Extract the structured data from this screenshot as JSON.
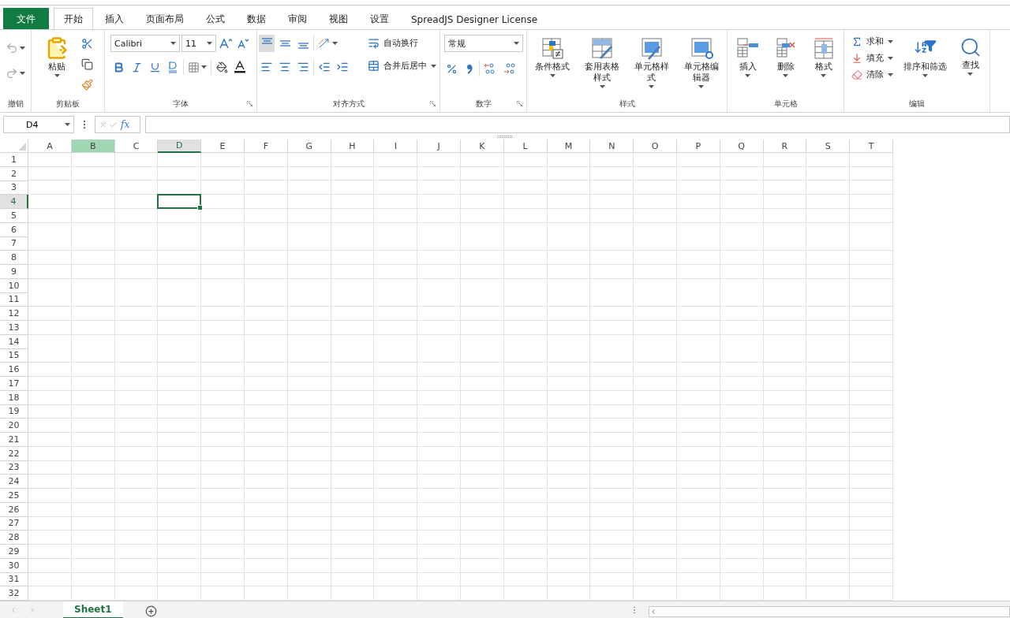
{
  "tabs": [
    {
      "label": "文件",
      "kind": "file",
      "selected": false
    },
    {
      "label": "开始",
      "kind": "tab",
      "selected": true
    },
    {
      "label": "插入",
      "kind": "tab",
      "selected": false
    },
    {
      "label": "页面布局",
      "kind": "tab",
      "selected": false
    },
    {
      "label": "公式",
      "kind": "tab",
      "selected": false
    },
    {
      "label": "数据",
      "kind": "tab",
      "selected": false
    },
    {
      "label": "审阅",
      "kind": "tab",
      "selected": false
    },
    {
      "label": "视图",
      "kind": "tab",
      "selected": false
    },
    {
      "label": "设置",
      "kind": "tab",
      "selected": false
    },
    {
      "label": "SpreadJS Designer License",
      "kind": "tab",
      "selected": false
    }
  ],
  "ribbon": {
    "undo": {
      "label": "撤销",
      "undo_disabled": true,
      "redo_disabled": true
    },
    "clipboard": {
      "label": "剪贴板",
      "paste": "粘贴"
    },
    "font": {
      "label": "字体",
      "family": "Calibri",
      "size": "11"
    },
    "alignment": {
      "label": "对齐方式",
      "top_align_selected": true,
      "wrap": "自动换行",
      "merge": "合并后居中"
    },
    "number": {
      "label": "数字",
      "format": "常规"
    },
    "styles": {
      "label": "样式",
      "buttons": [
        "条件格式",
        "套用表格样式",
        "单元格样式",
        "单元格编辑器"
      ]
    },
    "cells": {
      "label": "单元格",
      "buttons": [
        "插入",
        "删除",
        "格式"
      ]
    },
    "editing": {
      "label": "编辑",
      "small": [
        "求和",
        "填充",
        "清除"
      ],
      "buttons": [
        "排序和筛选",
        "查找"
      ]
    }
  },
  "formula_bar": {
    "name_box": "D4",
    "fx": "fx"
  },
  "grid": {
    "columns": [
      {
        "label": "A",
        "selected": false,
        "active": false
      },
      {
        "label": "B",
        "selected": true,
        "active": false
      },
      {
        "label": "C",
        "selected": false,
        "active": false
      },
      {
        "label": "D",
        "selected": false,
        "active": true
      },
      {
        "label": "E",
        "selected": false,
        "active": false
      },
      {
        "label": "F",
        "selected": false,
        "active": false
      },
      {
        "label": "G",
        "selected": false,
        "active": false
      },
      {
        "label": "H",
        "selected": false,
        "active": false
      },
      {
        "label": "I",
        "selected": false,
        "active": false
      },
      {
        "label": "J",
        "selected": false,
        "active": false
      },
      {
        "label": "K",
        "selected": false,
        "active": false
      },
      {
        "label": "L",
        "selected": false,
        "active": false
      },
      {
        "label": "M",
        "selected": false,
        "active": false
      },
      {
        "label": "N",
        "selected": false,
        "active": false
      },
      {
        "label": "O",
        "selected": false,
        "active": false
      },
      {
        "label": "P",
        "selected": false,
        "active": false
      },
      {
        "label": "Q",
        "selected": false,
        "active": false
      },
      {
        "label": "R",
        "selected": false,
        "active": false
      },
      {
        "label": "S",
        "selected": false,
        "active": false
      },
      {
        "label": "T",
        "selected": false,
        "active": false
      }
    ],
    "rows": [
      {
        "label": "1",
        "active": false
      },
      {
        "label": "2",
        "active": false
      },
      {
        "label": "3",
        "active": false
      },
      {
        "label": "4",
        "active": true
      },
      {
        "label": "5",
        "active": false
      },
      {
        "label": "6",
        "active": false
      },
      {
        "label": "7",
        "active": false
      },
      {
        "label": "8",
        "active": false
      },
      {
        "label": "9",
        "active": false
      },
      {
        "label": "10",
        "active": false
      },
      {
        "label": "11",
        "active": false
      },
      {
        "label": "12",
        "active": false
      },
      {
        "label": "13",
        "active": false
      },
      {
        "label": "14",
        "active": false
      },
      {
        "label": "15",
        "active": false
      },
      {
        "label": "16",
        "active": false
      },
      {
        "label": "17",
        "active": false
      },
      {
        "label": "18",
        "active": false
      },
      {
        "label": "19",
        "active": false
      },
      {
        "label": "20",
        "active": false
      },
      {
        "label": "21",
        "active": false
      },
      {
        "label": "22",
        "active": false
      },
      {
        "label": "23",
        "active": false
      },
      {
        "label": "24",
        "active": false
      },
      {
        "label": "25",
        "active": false
      },
      {
        "label": "26",
        "active": false
      },
      {
        "label": "27",
        "active": false
      },
      {
        "label": "28",
        "active": false
      },
      {
        "label": "29",
        "active": false
      },
      {
        "label": "30",
        "active": false
      },
      {
        "label": "31",
        "active": false
      },
      {
        "label": "32",
        "active": false
      }
    ]
  },
  "sheet_tabs": [
    {
      "label": "Sheet1",
      "selected": true
    }
  ]
}
